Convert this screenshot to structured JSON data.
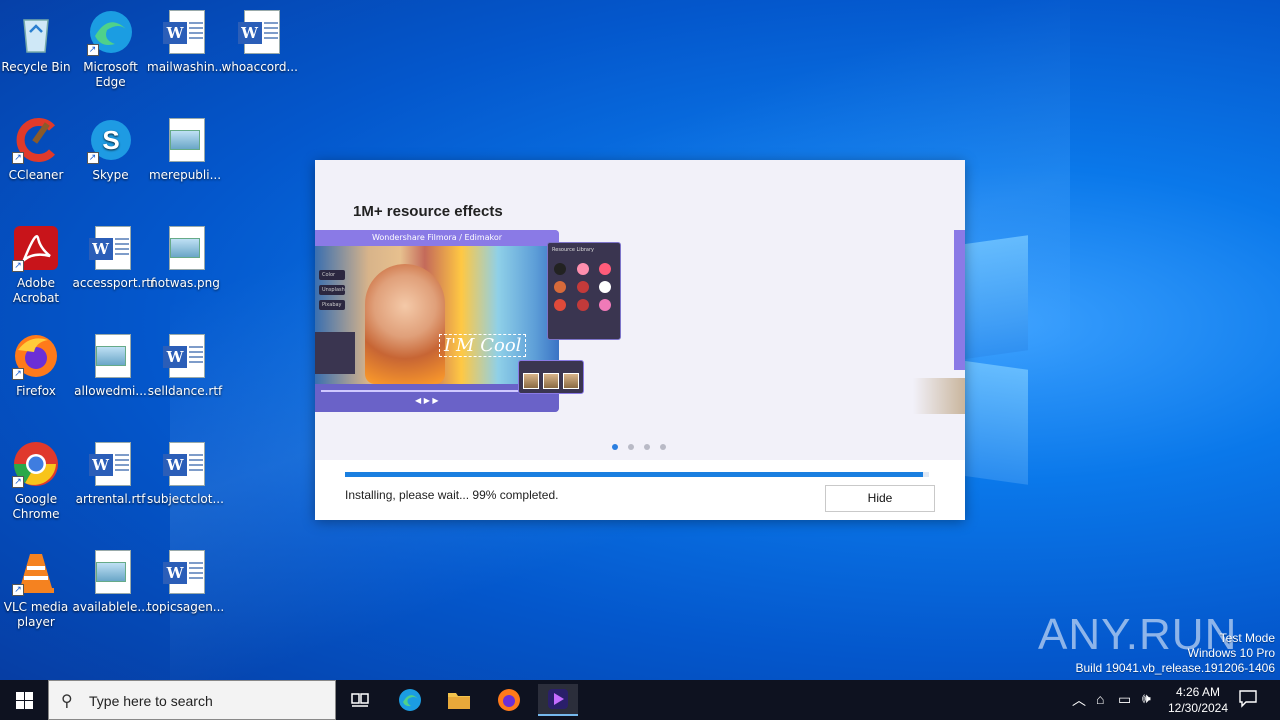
{
  "desktop": {
    "icons": [
      {
        "label": "Recycle Bin",
        "icon": "recycle-bin-icon"
      },
      {
        "label": "Microsoft Edge",
        "icon": "edge-icon"
      },
      {
        "label": "mailwashin...",
        "icon": "word-doc-icon"
      },
      {
        "label": "whoaccord...",
        "icon": "word-doc-icon"
      },
      {
        "label": "CCleaner",
        "icon": "ccleaner-icon"
      },
      {
        "label": "Skype",
        "icon": "skype-icon"
      },
      {
        "label": "merepubli...",
        "icon": "image-file-icon"
      },
      {
        "label": "Adobe Acrobat",
        "icon": "acrobat-icon"
      },
      {
        "label": "accessport.rtf",
        "icon": "word-doc-icon"
      },
      {
        "label": "notwas.png",
        "icon": "image-file-icon"
      },
      {
        "label": "Firefox",
        "icon": "firefox-icon"
      },
      {
        "label": "allowedmi...",
        "icon": "image-file-icon"
      },
      {
        "label": "selldance.rtf",
        "icon": "word-doc-icon"
      },
      {
        "label": "Google Chrome",
        "icon": "chrome-icon"
      },
      {
        "label": "artrental.rtf",
        "icon": "word-doc-icon"
      },
      {
        "label": "subjectclot...",
        "icon": "word-doc-icon"
      },
      {
        "label": "VLC media player",
        "icon": "vlc-icon"
      },
      {
        "label": "availablele...",
        "icon": "image-file-icon"
      },
      {
        "label": "topicsagen...",
        "icon": "word-doc-icon"
      }
    ]
  },
  "installer": {
    "slide_title": "1M+ resource effects",
    "mock_app_title": "Wondershare Filmora / Edimakor",
    "mock_overlay_text": "I'M Cool",
    "mock_library_title": "Resource Library",
    "mock_side_items": [
      "Color",
      "Unsplash",
      "Pixabay"
    ],
    "carousel_pages": 4,
    "carousel_active": 0,
    "progress_percent": 99,
    "status": "Installing, please wait... 99% completed.",
    "hide_label": "Hide"
  },
  "watermark": "ANY.RUN",
  "system_info": {
    "line1": "Test Mode",
    "line2": "Windows 10 Pro",
    "line3": "Build 19041.vb_release.191206-1406"
  },
  "taskbar": {
    "search_placeholder": "Type here to search",
    "pinned": [
      "task-view-icon",
      "edge-icon",
      "file-explorer-icon",
      "firefox-icon",
      "installer-app-icon"
    ],
    "time": "4:26 AM",
    "date": "12/30/2024"
  }
}
